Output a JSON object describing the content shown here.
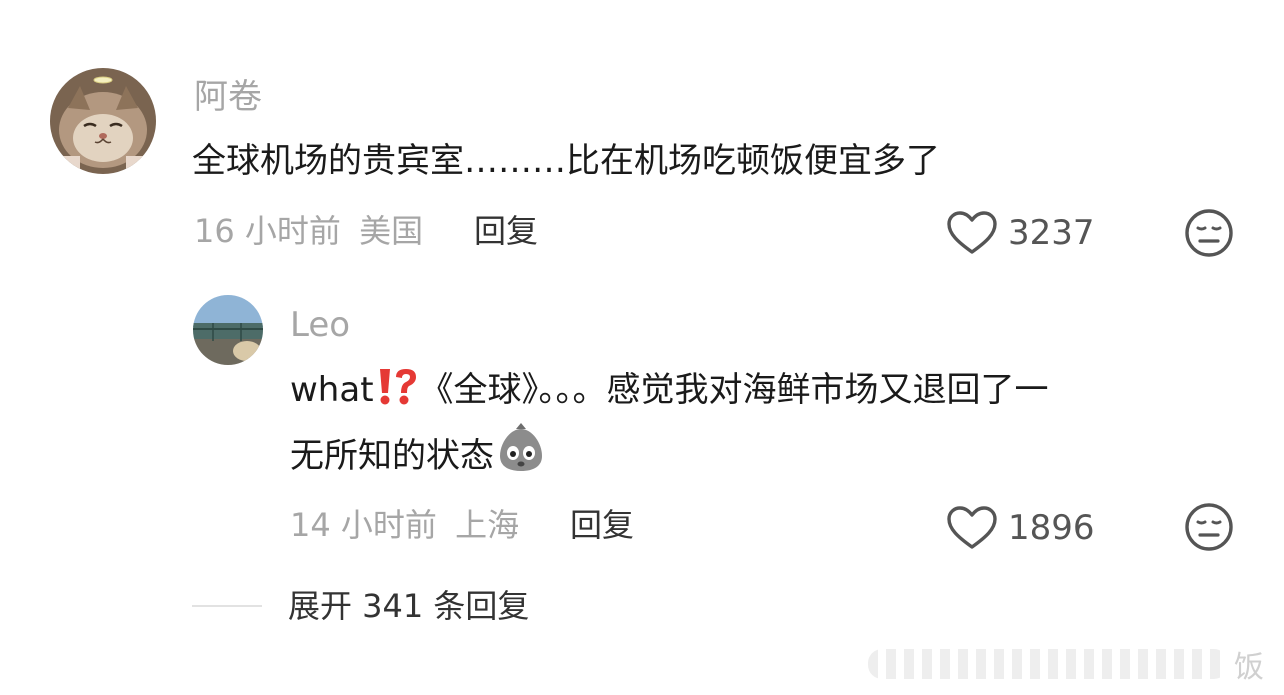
{
  "comments": [
    {
      "username": "阿卷",
      "text": "全球机场的贵宾室………比在机场吃顿饭便宜多了",
      "time": "16 小时前",
      "location": "美国",
      "reply_label": "回复",
      "likes": "3237"
    }
  ],
  "reply": {
    "username": "Leo",
    "text_prefix": "what",
    "text_line1": "《全球》。。。感觉我对海鲜市场又退回了一",
    "text_line2": "无所知的状态",
    "time": "14 小时前",
    "location": "上海",
    "reply_label": "回复",
    "likes": "1896"
  },
  "expand_label": "展开 341 条回复",
  "watermark_text": "饭",
  "colors": {
    "secondary_text": "#a6a6a6",
    "primary_text": "#1a1a1a",
    "emoji_red": "#e53935"
  }
}
